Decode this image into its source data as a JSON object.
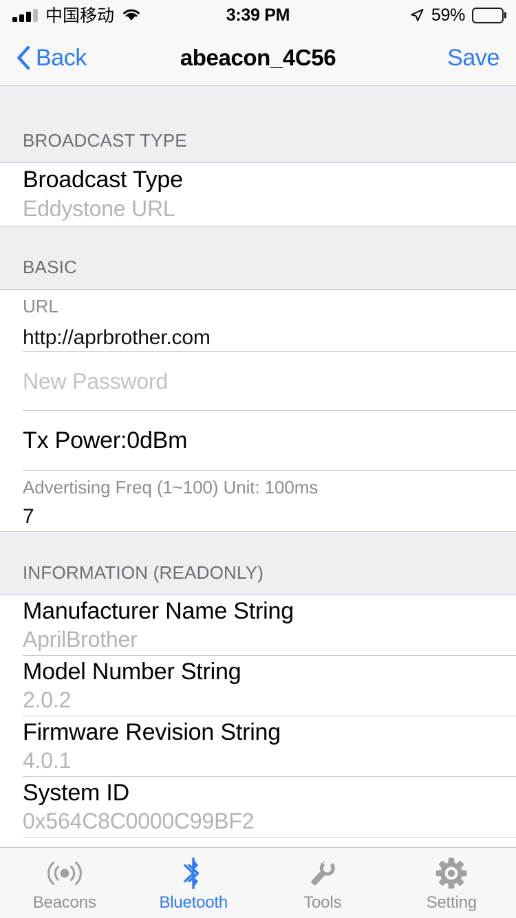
{
  "status_bar": {
    "carrier": "中国移动",
    "time": "3:39 PM",
    "battery_percent": "59%",
    "battery_level": 59,
    "signal_icon": "signal-bars-icon",
    "wifi_icon": "wifi-icon",
    "location_icon": "location-arrow-icon",
    "battery_icon": "battery-icon"
  },
  "nav_bar": {
    "back_label": "Back",
    "back_icon": "chevron-left-icon",
    "title": "abeacon_4C56",
    "save_label": "Save"
  },
  "sections": [
    {
      "header": "BROADCAST TYPE",
      "rows": [
        {
          "title": "Broadcast Type",
          "value": "Eddystone URL"
        }
      ]
    },
    {
      "header": "BASIC",
      "rows": [
        {
          "label": "URL",
          "value": "http://aprbrother.com"
        },
        {
          "placeholder": "New Password",
          "value": ""
        },
        {
          "title": "Tx Power:0dBm"
        },
        {
          "label": "Advertising Freq (1~100) Unit: 100ms",
          "value": "7"
        }
      ]
    },
    {
      "header": "INFORMATION (READONLY)",
      "rows": [
        {
          "title": "Manufacturer Name String",
          "value": "AprilBrother"
        },
        {
          "title": "Model Number String",
          "value": "2.0.2"
        },
        {
          "title": "Firmware Revision String",
          "value": "4.0.1"
        },
        {
          "title": "System ID",
          "value": "0x564C8C0000C99BF2"
        }
      ]
    }
  ],
  "tab_bar": {
    "active_index": 1,
    "items": [
      {
        "label": "Beacons",
        "icon": "broadcast-icon"
      },
      {
        "label": "Bluetooth",
        "icon": "bluetooth-icon"
      },
      {
        "label": "Tools",
        "icon": "wrench-icon"
      },
      {
        "label": "Setting",
        "icon": "gear-icon"
      }
    ]
  },
  "colors": {
    "accent": "#2f7cf6",
    "section_bg": "#efeef3",
    "bar_bg": "#f8f8f8",
    "separator": "#c8c7cc",
    "secondary_text": "#8e8e93",
    "value_text": "#b4b4b9",
    "tab_inactive": "#919196"
  }
}
